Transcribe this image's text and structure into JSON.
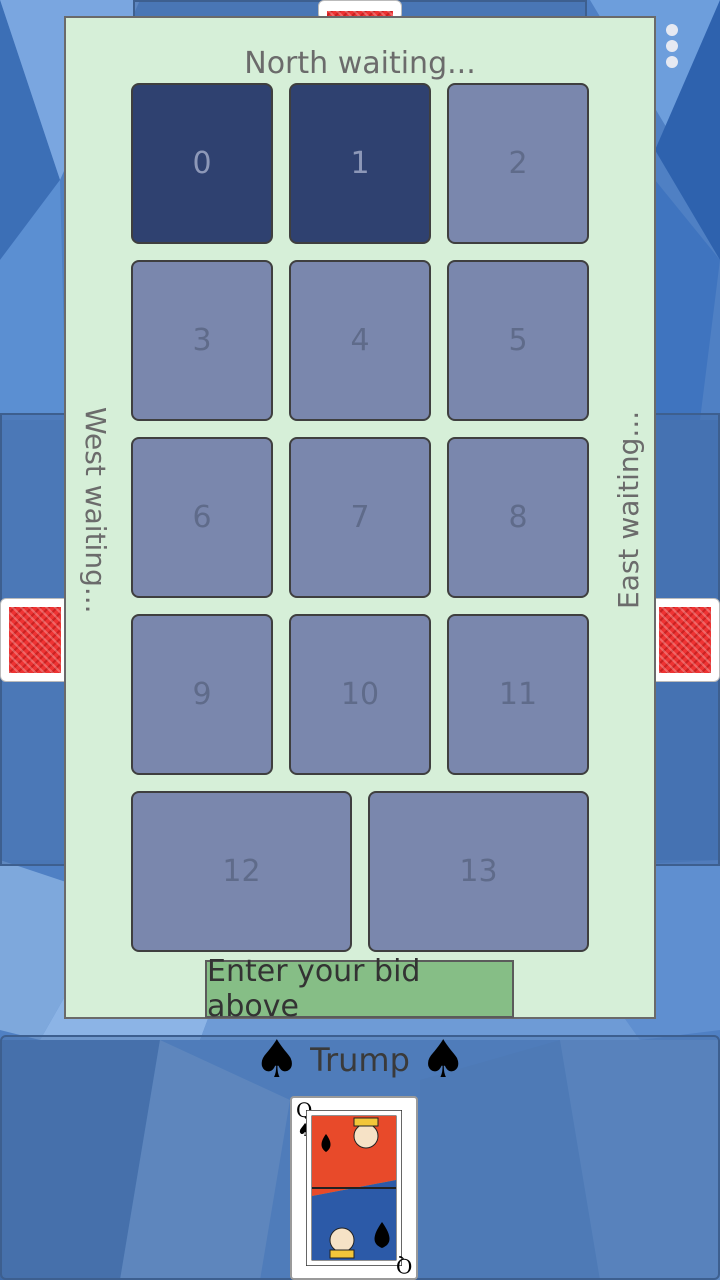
{
  "players": {
    "north_status": "North waiting...",
    "west_status": "West waiting...",
    "east_status": "East waiting..."
  },
  "bids": [
    "0",
    "1",
    "2",
    "3",
    "4",
    "5",
    "6",
    "7",
    "8",
    "9",
    "10",
    "11",
    "12",
    "13"
  ],
  "highlighted_bids": [
    "0",
    "1"
  ],
  "prompt": "Enter your bid above",
  "trump": {
    "label": "Trump",
    "suit_symbol": "♠",
    "card": {
      "rank": "Q",
      "suit": "spades",
      "rank_label": "Q",
      "suit_glyph": "♠"
    }
  },
  "colors": {
    "dialog_bg": "#d6efd8",
    "bid_default": "#7a87ad",
    "bid_highlight": "#2f4170",
    "prompt_bg": "#86be86",
    "card_back": "#e33"
  }
}
